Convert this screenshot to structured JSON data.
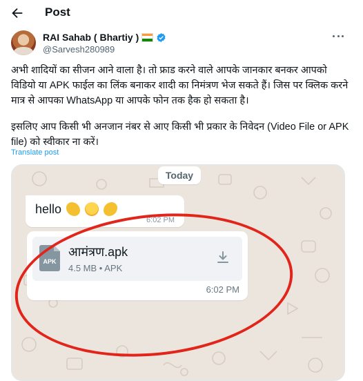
{
  "header": {
    "title": "Post"
  },
  "author": {
    "name": "RAI Sahab ( Bhartiy )",
    "handle": "@Sarvesh280989"
  },
  "post": {
    "paragraph1": "अभी शादियों का सीजन आने वाला है। तो फ्राड करने वाले आपके जानकार बनकर आपको विडियो या APK फाईल का लिंक बनाकर शादी का निमंत्रण भेज सकते हैं। जिस पर क्लिक करने मात्र से आपका WhatsApp या आपके फोन तक हैक हो सकता है।",
    "paragraph2": "इसलिए आप किसी भी अनजान नंबर से आए किसी भी प्रकार के निवेदन (Video File or APK file) को स्वीकार ना करें।",
    "translate_label": "Translate post"
  },
  "chat": {
    "date_label": "Today",
    "message1": {
      "text": "hello",
      "time": "6:02 PM"
    },
    "file": {
      "type_badge": "APK",
      "name": "आमंत्रण.apk",
      "meta": "4.5 MB • APK",
      "time": "6:02 PM"
    }
  },
  "colors": {
    "accent_blue": "#1d9bf0",
    "chat_bg": "#ece5dd",
    "annotation_red": "#e1251b"
  }
}
